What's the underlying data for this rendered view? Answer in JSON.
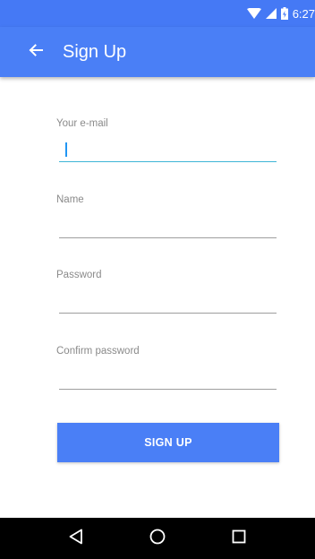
{
  "status_bar": {
    "time": "6:27"
  },
  "app_bar": {
    "title": "Sign Up"
  },
  "form": {
    "email": {
      "label": "Your e-mail",
      "value": ""
    },
    "name": {
      "label": "Name",
      "value": ""
    },
    "password": {
      "label": "Password",
      "value": ""
    },
    "confirm_password": {
      "label": "Confirm password",
      "value": ""
    }
  },
  "signup_button": {
    "label": "SIGN UP"
  },
  "icons": {
    "back": "arrow-left-icon",
    "wifi": "wifi-icon",
    "signal": "cell-signal-icon",
    "battery": "battery-charging-icon",
    "nav_back": "triangle-back-icon",
    "nav_home": "circle-home-icon",
    "nav_recents": "square-recents-icon"
  },
  "colors": {
    "primary": "#4a7ff6",
    "status_bar": "#4579f5",
    "focus_underline": "#3fb5d6",
    "nav_bar": "#000000"
  }
}
